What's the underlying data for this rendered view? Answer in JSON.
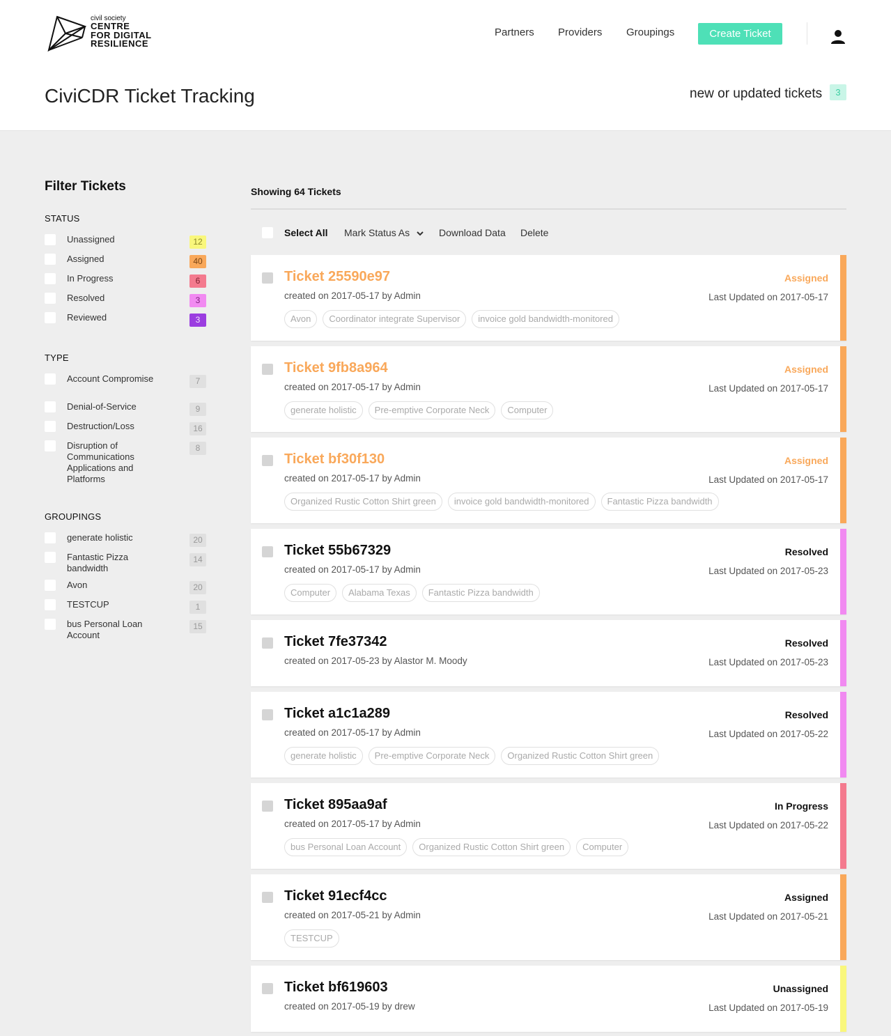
{
  "header": {
    "logo_small": "civil society",
    "logo_line1": "CENTRE",
    "logo_line2": "FOR DIGITAL",
    "logo_line3": "RESILIENCE",
    "nav": [
      "Partners",
      "Providers",
      "Groupings"
    ],
    "create_button": "Create Ticket",
    "user_icon": "user-icon"
  },
  "titlebar": {
    "title": "CiviCDR Ticket Tracking",
    "updated_label": "new or updated tickets",
    "updated_count": "3"
  },
  "sidebar": {
    "title": "Filter Tickets",
    "status_title": "STATUS",
    "status": [
      {
        "label": "Unassigned",
        "count": "12",
        "bg": "#f9f77c",
        "fg": "#8d8a2a"
      },
      {
        "label": "Assigned",
        "count": "40",
        "bg": "#f9a85a",
        "fg": "#7a4515"
      },
      {
        "label": "In Progress",
        "count": "6",
        "bg": "#f47a8e",
        "fg": "#7a1f2e"
      },
      {
        "label": "Resolved",
        "count": "3",
        "bg": "#f18af1",
        "fg": "#7b1f7b"
      },
      {
        "label": "Reviewed",
        "count": "3",
        "bg": "#9b3de0",
        "fg": "#f2e4fb"
      }
    ],
    "type_title": "TYPE",
    "types": [
      {
        "label": "Account Compromise",
        "count": "7"
      },
      {
        "label": "Denial-of-Service",
        "count": "9"
      },
      {
        "label": "Destruction/Loss",
        "count": "16"
      },
      {
        "label": "Disruption of Communications Applications and Platforms",
        "count": "8"
      }
    ],
    "groupings_title": "GROUPINGS",
    "groupings": [
      {
        "label": "generate holistic",
        "count": "20"
      },
      {
        "label": "Fantastic Pizza bandwidth",
        "count": "14"
      },
      {
        "label": "Avon",
        "count": "20"
      },
      {
        "label": "TESTCUP",
        "count": "1"
      },
      {
        "label": "bus Personal Loan Account",
        "count": "15"
      }
    ]
  },
  "main": {
    "showing": "Showing 64 Tickets",
    "bulk": {
      "select_all": "Select All",
      "mark_status": "Mark Status As",
      "download": "Download Data",
      "delete": "Delete"
    },
    "tickets": [
      {
        "title": "Ticket 25590e97",
        "created": "created on 2017-05-17 by Admin",
        "status": "Assigned",
        "updated": "Last Updated on 2017-05-17",
        "tags": [
          "Avon",
          "Coordinator integrate Supervisor",
          "invoice gold bandwidth-monitored"
        ],
        "title_color": "#f9a85a",
        "status_color": "#f9a85a",
        "bar_color": "#f9a85a"
      },
      {
        "title": "Ticket 9fb8a964",
        "created": "created on 2017-05-17 by Admin",
        "status": "Assigned",
        "updated": "Last Updated on 2017-05-17",
        "tags": [
          "generate holistic",
          "Pre-emptive Corporate Neck",
          "Computer"
        ],
        "title_color": "#f9a85a",
        "status_color": "#f9a85a",
        "bar_color": "#f9a85a"
      },
      {
        "title": "Ticket bf30f130",
        "created": "created on 2017-05-17 by Admin",
        "status": "Assigned",
        "updated": "Last Updated on 2017-05-17",
        "tags": [
          "Organized Rustic Cotton Shirt green",
          "invoice gold bandwidth-monitored",
          "Fantastic Pizza bandwidth"
        ],
        "title_color": "#f9a85a",
        "status_color": "#f9a85a",
        "bar_color": "#f9a85a"
      },
      {
        "title": "Ticket 55b67329",
        "created": "created on 2017-05-17 by Admin",
        "status": "Resolved",
        "updated": "Last Updated on 2017-05-23",
        "tags": [
          "Computer",
          "Alabama Texas",
          "Fantastic Pizza bandwidth"
        ],
        "title_color": "#111111",
        "status_color": "#111111",
        "bar_color": "#f18af1"
      },
      {
        "title": "Ticket 7fe37342",
        "created": "created on 2017-05-23 by Alastor M. Moody",
        "status": "Resolved",
        "updated": "Last Updated on 2017-05-23",
        "tags": [],
        "title_color": "#111111",
        "status_color": "#111111",
        "bar_color": "#f18af1"
      },
      {
        "title": "Ticket a1c1a289",
        "created": "created on 2017-05-17 by Admin",
        "status": "Resolved",
        "updated": "Last Updated on 2017-05-22",
        "tags": [
          "generate holistic",
          "Pre-emptive Corporate Neck",
          "Organized Rustic Cotton Shirt green"
        ],
        "title_color": "#111111",
        "status_color": "#111111",
        "bar_color": "#f18af1"
      },
      {
        "title": "Ticket 895aa9af",
        "created": "created on 2017-05-17 by Admin",
        "status": "In Progress",
        "updated": "Last Updated on 2017-05-22",
        "tags": [
          "bus Personal Loan Account",
          "Organized Rustic Cotton Shirt green",
          "Computer"
        ],
        "title_color": "#111111",
        "status_color": "#111111",
        "bar_color": "#f47a8e"
      },
      {
        "title": "Ticket 91ecf4cc",
        "created": "created on 2017-05-21 by Admin",
        "status": "Assigned",
        "updated": "Last Updated on 2017-05-21",
        "tags": [
          "TESTCUP"
        ],
        "title_color": "#111111",
        "status_color": "#111111",
        "bar_color": "#f9a85a"
      },
      {
        "title": "Ticket bf619603",
        "created": "created on 2017-05-19 by drew",
        "status": "Unassigned",
        "updated": "Last Updated on 2017-05-19",
        "tags": [],
        "title_color": "#111111",
        "status_color": "#111111",
        "bar_color": "#f9f77c"
      }
    ]
  }
}
